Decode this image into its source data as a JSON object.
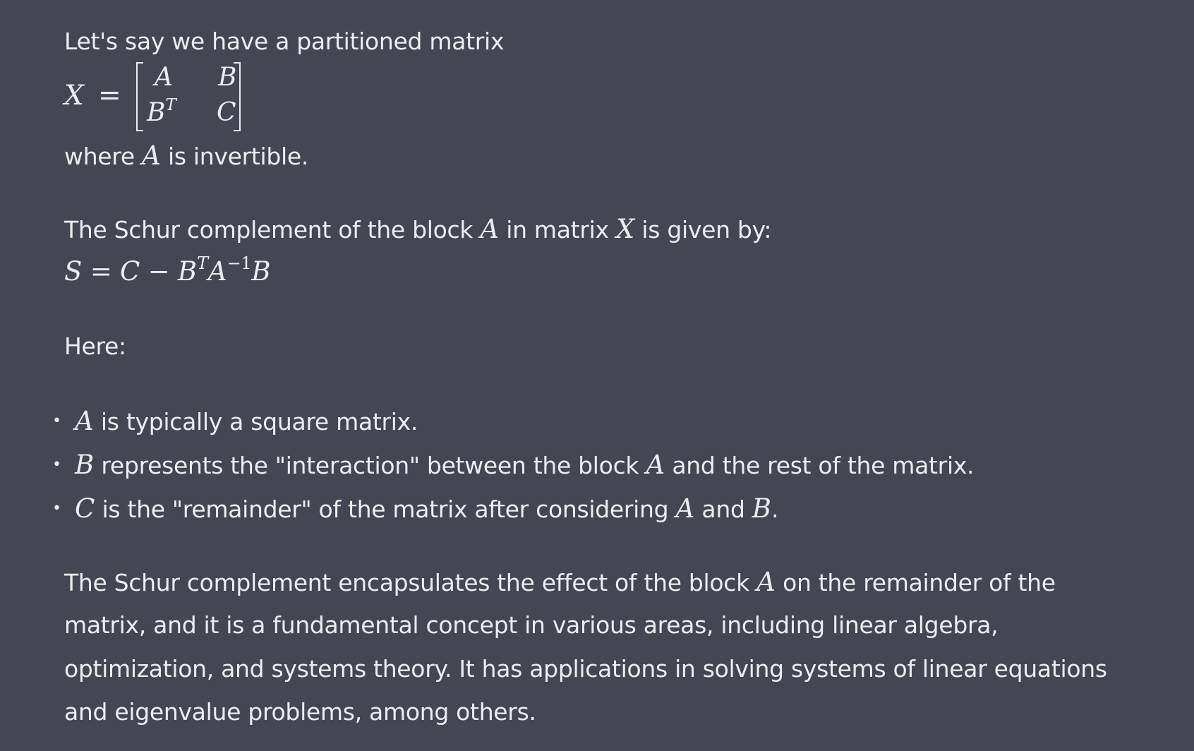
{
  "intro": {
    "text": "Let's say we have a partitioned matrix"
  },
  "matrix": {
    "lhs": "X",
    "equals": "=",
    "a11": "A",
    "a12": "B",
    "a21_base": "B",
    "a21_sup": "T",
    "a22": "C"
  },
  "where_line": {
    "prefix": "where ",
    "var": "A",
    "suffix": " is invertible."
  },
  "schur_line": {
    "prefix": "The Schur complement of the block ",
    "var1": "A",
    "middle": " in matrix ",
    "var2": "X",
    "suffix": " is given by:"
  },
  "formula": {
    "s": "S",
    "eq": " = ",
    "c": "C",
    "minus": " − ",
    "b1": "B",
    "t": "T",
    "a": "A",
    "inv": "−1",
    "b2": "B"
  },
  "here": {
    "text": "Here:"
  },
  "bullets": [
    {
      "var": "A",
      "text": " is typically a square matrix."
    },
    {
      "var": "B",
      "text": " represents the \"interaction\" between the block ",
      "var2": "A",
      "text2": " and the rest of the matrix."
    },
    {
      "var": "C",
      "text": " is the \"remainder\" of the matrix after considering ",
      "var2": "A",
      "text2": " and ",
      "var3": "B",
      "text3": "."
    }
  ],
  "bullet_symbol": "•",
  "closing": {
    "line1_prefix": "The Schur complement encapsulates the effect of the block ",
    "line1_var": "A",
    "line1_suffix": " on the remainder of the",
    "line2": "matrix, and it is a fundamental concept in various areas, including linear algebra,",
    "line3": "optimization, and systems theory. It has applications in solving systems of linear equations",
    "line4": "and eigenvalue problems, among others."
  }
}
